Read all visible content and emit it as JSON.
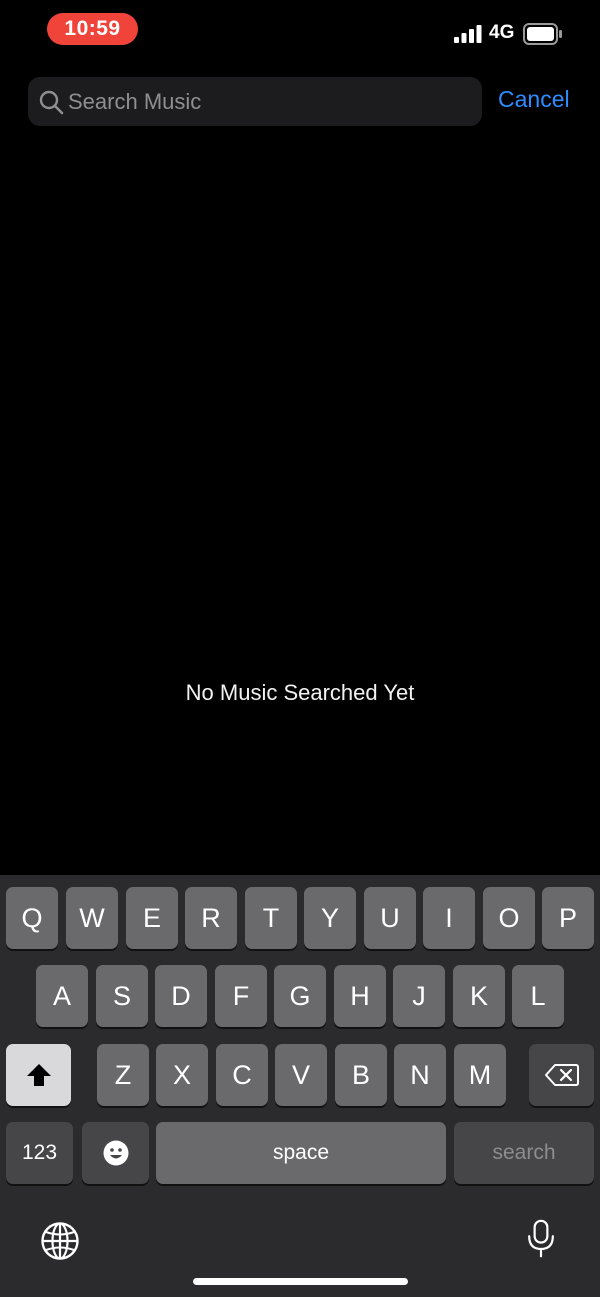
{
  "status_bar": {
    "time": "10:59",
    "network": "4G",
    "signal_icon": "cellular-signal-icon",
    "battery_icon": "battery-icon",
    "time_pill_color": "#f0443a"
  },
  "search": {
    "placeholder": "Search Music",
    "value": "",
    "cancel_label": "Cancel",
    "icon": "search-icon",
    "accent_color": "#2f8cff"
  },
  "main": {
    "empty_message": "No Music Searched Yet"
  },
  "keyboard": {
    "row1": [
      "Q",
      "W",
      "E",
      "R",
      "T",
      "Y",
      "U",
      "I",
      "O",
      "P"
    ],
    "row2": [
      "A",
      "S",
      "D",
      "F",
      "G",
      "H",
      "J",
      "K",
      "L"
    ],
    "row3": [
      "Z",
      "X",
      "C",
      "V",
      "B",
      "N",
      "M"
    ],
    "shift_icon": "shift-arrow-icon",
    "delete_icon": "delete-backspace-icon",
    "numbers_label": "123",
    "emoji_icon": "emoji-icon",
    "space_label": "space",
    "search_label": "search",
    "globe_icon": "globe-icon",
    "mic_icon": "microphone-icon"
  }
}
